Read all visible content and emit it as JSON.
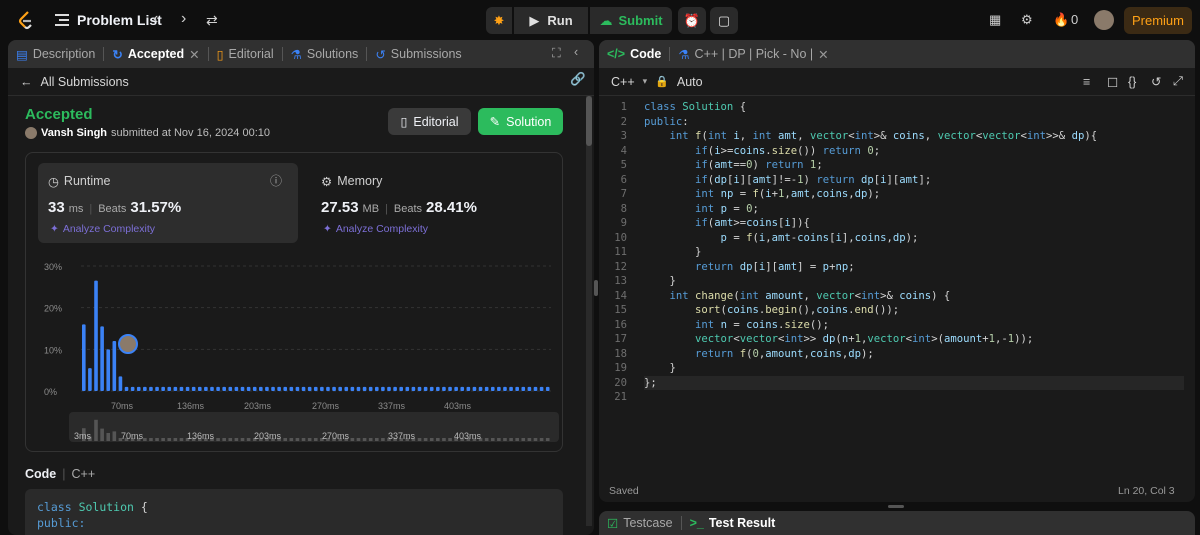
{
  "topbar": {
    "problem_list": "Problem List",
    "run": "Run",
    "submit": "Submit",
    "streak": "0",
    "premium": "Premium"
  },
  "left": {
    "tabs": [
      "Description",
      "Accepted",
      "Editorial",
      "Solutions",
      "Submissions"
    ],
    "all_submissions": "All Submissions",
    "status": "Accepted",
    "user": "Vansh Singh",
    "submitted_at": "submitted at Nov 16, 2024 00:10",
    "editorial_btn": "Editorial",
    "solution_btn": "Solution",
    "runtime": {
      "label": "Runtime",
      "value": "33",
      "unit": "ms",
      "beats_label": "Beats",
      "beats": "31.57%",
      "analyze": "Analyze Complexity"
    },
    "memory": {
      "label": "Memory",
      "value": "27.53",
      "unit": "MB",
      "beats_label": "Beats",
      "beats": "28.41%",
      "analyze": "Analyze Complexity"
    },
    "code_label": "Code",
    "code_lang": "C++",
    "code_preview": [
      "class Solution {",
      "public:"
    ]
  },
  "chart_data": {
    "type": "bar",
    "ylabel_ticks": [
      "30%",
      "20%",
      "10%",
      "0%"
    ],
    "xlabel_ticks": [
      "70ms",
      "136ms",
      "203ms",
      "270ms",
      "337ms",
      "403ms"
    ],
    "mini_ticks": [
      "3ms",
      "70ms",
      "136ms",
      "203ms",
      "270ms",
      "337ms",
      "403ms"
    ],
    "ylim": [
      0,
      30
    ],
    "values": [
      16,
      5.5,
      26.5,
      15.5,
      10,
      12,
      3.5,
      1,
      1,
      1,
      1,
      1,
      1,
      1,
      1,
      1,
      1,
      1,
      1,
      1,
      1,
      1,
      1,
      1,
      1,
      1,
      1,
      1,
      1,
      1,
      1,
      1,
      1,
      1,
      1,
      1,
      1,
      1,
      1,
      1,
      1,
      1,
      1,
      1,
      1,
      1,
      1,
      1,
      1,
      1,
      1,
      1,
      1,
      1,
      1,
      1,
      1,
      1,
      1,
      1,
      1,
      1,
      1,
      1,
      1,
      1,
      1,
      1,
      1,
      1,
      1,
      1,
      1,
      1,
      1,
      1,
      1
    ]
  },
  "right": {
    "code_tab": "Code",
    "file_tab": "C++ | DP | Pick - No |",
    "lang": "C++",
    "mode": "Auto",
    "saved": "Saved",
    "cursor": "Ln 20, Col 3",
    "bottom_tabs": [
      "Testcase",
      "Test Result"
    ],
    "lines": [
      "class Solution {",
      "public:",
      "    int f(int i, int amt, vector<int>& coins, vector<vector<int>>& dp){",
      "        if(i>=coins.size()) return 0;",
      "        if(amt==0) return 1;",
      "        if(dp[i][amt]!=-1) return dp[i][amt];",
      "        int np = f(i+1,amt,coins,dp);",
      "        int p = 0;",
      "        if(amt>=coins[i]){",
      "            p = f(i,amt-coins[i],coins,dp);",
      "        }",
      "        return dp[i][amt] = p+np;",
      "    }",
      "    int change(int amount, vector<int>& coins) {",
      "        sort(coins.begin(),coins.end());",
      "        int n = coins.size();",
      "        vector<vector<int>> dp(n+1,vector<int>(amount+1,-1));",
      "        return f(0,amount,coins,dp);",
      "    }",
      "};",
      ""
    ]
  }
}
